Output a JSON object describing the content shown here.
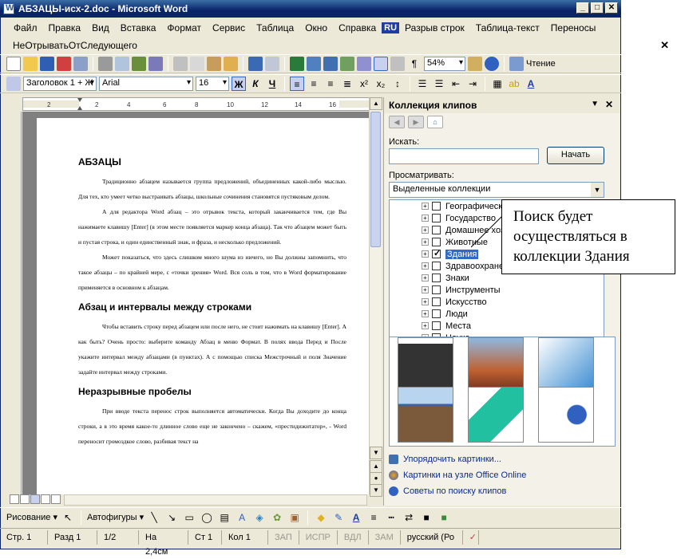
{
  "window": {
    "title": "АБЗАЦЫ-исх-2.doc - Microsoft Word"
  },
  "menu": {
    "items": [
      "Файл",
      "Правка",
      "Вид",
      "Вставка",
      "Формат",
      "Сервис",
      "Таблица",
      "Окно",
      "Справка"
    ],
    "lang": "RU",
    "extra": [
      "Разрыв строк",
      "Таблица-текст",
      "Переносы"
    ],
    "row2": "НеОтрыватьОтСледующего"
  },
  "toolbar": {
    "zoom": "54%",
    "reading": "Чтение"
  },
  "format": {
    "style": "Заголовок 1 + Ж",
    "font": "Arial",
    "size": "16",
    "bold": "Ж",
    "italic": "К",
    "underline": "Ч"
  },
  "document": {
    "heading1": "АБЗАЦЫ",
    "para1": "Традиционно абзацем называется группа предложений, объединенных какой-либо мыслью. Для тех, кто умеет четко выстраивать абзацы, школьные сочинения становятся пустяковым делом.",
    "para2": "А для редактора Word абзац – это отрывок текста, который заканчивается тем, где Вы нажимаете клавишу [Enter] (в этом месте появляется маркер конца абзаца). Так что абзацем может быть и пустая строка, и один единственный знак, и фраза, и несколько предложений.",
    "para3": "Может показаться, что здесь слишком много шума из ничего, но Вы должны запомнить, что такое абзацы – по крайней мере, с «точки зрения» Word. Вся соль в том, что в Word форматирование применяется в основном к абзацам.",
    "heading2": "Абзац и интервалы между строками",
    "para4": "Чтобы вставить строку перед абзацем или после него, не стоит нажимать на клавишу [Enter]. А как быть? Очень просто: выберите команду Абзац в меню Формат. В полях ввода Перед и После укажите интервал между абзацами (в пунктах). А с помощью списка Межстрочный и поля Значение задайте интервал между строками.",
    "heading3": "Неразрывные пробелы",
    "para5": "При вводе текста перенос строк выполняется автоматически. Когда Вы доходите до конца строки, а в это время какое-то длинное слово еще не закончено – скажем, «престидижитатор», - Word переносит громоздкое слово, разбивая текст на"
  },
  "taskpane": {
    "title": "Коллекция клипов",
    "search_label": "Искать:",
    "search_value": "",
    "go_button": "Начать",
    "browse_label": "Просматривать:",
    "browse_value": "Выделенные коллекции",
    "tree": [
      {
        "label": "Географическ",
        "checked": false
      },
      {
        "label": "Государство",
        "checked": false
      },
      {
        "label": "Домашнее хоз",
        "checked": false
      },
      {
        "label": "Животные",
        "checked": false
      },
      {
        "label": "Здания",
        "checked": true
      },
      {
        "label": "Здравоохранен",
        "checked": false
      },
      {
        "label": "Знаки",
        "checked": false
      },
      {
        "label": "Инструменты",
        "checked": false
      },
      {
        "label": "Искусство",
        "checked": false
      },
      {
        "label": "Люди",
        "checked": false
      },
      {
        "label": "Места",
        "checked": false
      },
      {
        "label": "Наука",
        "checked": false
      }
    ],
    "links": [
      "Упорядочить картинки...",
      "Картинки на узле Office Online",
      "Советы по поиску клипов"
    ]
  },
  "callout": "Поиск будет осуществляться в коллекции Здания",
  "drawing": {
    "draw_label": "Рисование ▾",
    "autoshapes_label": "Автофигуры ▾"
  },
  "status": {
    "page": "Стр. 1",
    "section": "Разд 1",
    "pages": "1/2",
    "at": "На 2,4см",
    "line": "Ст 1",
    "col": "Кол 1",
    "rec": "ЗАП",
    "trk": "ИСПР",
    "ext": "ВДЛ",
    "ovr": "ЗАМ",
    "lang": "русский (Ро"
  }
}
